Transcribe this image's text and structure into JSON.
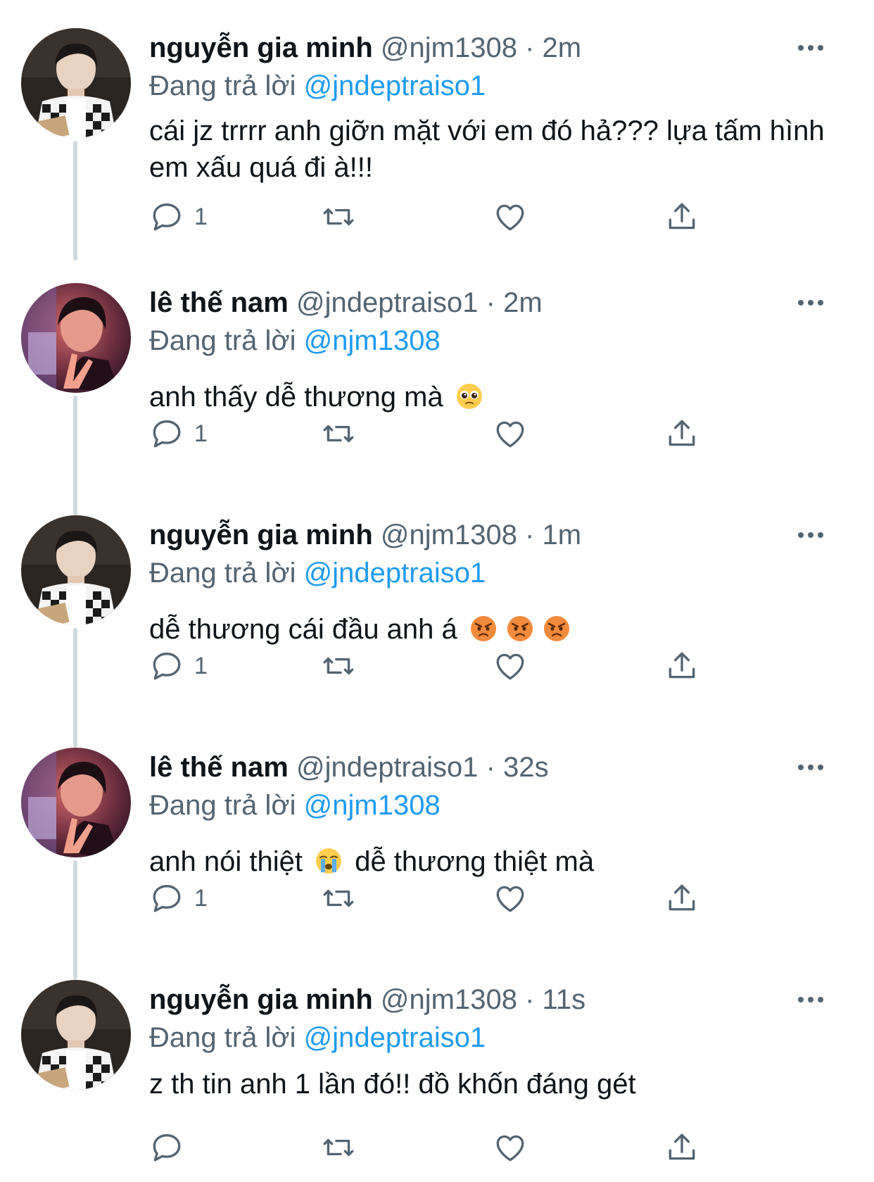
{
  "reply_prefix": "Đang trả lời",
  "tweets": [
    {
      "name": "nguyễn gia minh",
      "handle": "@njm1308",
      "time": "2m",
      "reply_to": "@jndeptraiso1",
      "text_parts": [
        "cái jz trrrr anh giỡn mặt với em đó hả??? lựa tấm hình em xấu quá đi à!!!"
      ],
      "reply_count": "1",
      "avatar": "boy-checkered-cardigan"
    },
    {
      "name": "lê thế nam",
      "handle": "@jndeptraiso1",
      "time": "2m",
      "reply_to": "@njm1308",
      "text_parts": [
        "anh thấy dễ thương mà"
      ],
      "emojis": [
        "pleading-face-emoji"
      ],
      "reply_count": "1",
      "avatar": "boy-red-light-peace-sign"
    },
    {
      "name": "nguyễn gia minh",
      "handle": "@njm1308",
      "time": "1m",
      "reply_to": "@jndeptraiso1",
      "text_parts": [
        "dễ thương cái đầu anh á"
      ],
      "emojis": [
        "angry-face-emoji",
        "angry-face-emoji",
        "angry-face-emoji"
      ],
      "reply_count": "1",
      "avatar": "boy-checkered-cardigan"
    },
    {
      "name": "lê thế nam",
      "handle": "@jndeptraiso1",
      "time": "32s",
      "reply_to": "@njm1308",
      "text_parts": [
        "anh nói thiệt",
        "dễ thương thiệt mà"
      ],
      "emojis": [
        "loudly-crying-face-emoji"
      ],
      "reply_count": "1",
      "avatar": "boy-red-light-peace-sign"
    },
    {
      "name": "nguyễn gia minh",
      "handle": "@njm1308",
      "time": "11s",
      "reply_to": "@jndeptraiso1",
      "text_parts": [
        "z th tin anh 1 lần đó!! đồ khốn đáng gét"
      ],
      "reply_count": "",
      "avatar": "boy-checkered-cardigan"
    }
  ],
  "icons": {
    "reply": "speech-bubble-icon",
    "retweet": "retweet-arrows-icon",
    "like": "heart-icon",
    "share": "share-upload-icon",
    "more": "ellipsis-icon"
  },
  "colors": {
    "link": "#1d9bf0",
    "secondary": "#536471",
    "thread_line": "#cfd9de"
  }
}
